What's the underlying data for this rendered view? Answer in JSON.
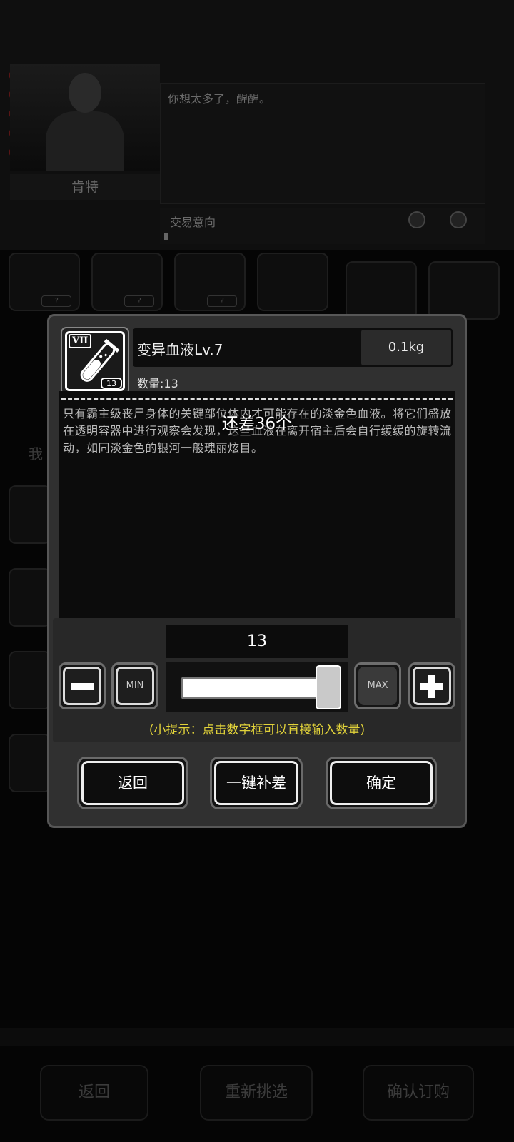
{
  "background": {
    "npc_name": "肯特",
    "dialog_text": "你想太多了，醒醒。",
    "trade_intent_label": "交易意向",
    "side_tab_label": "我",
    "slot_tag": "?",
    "buttons": {
      "back": "返回",
      "reselect": "重新挑选",
      "confirm_order": "确认订购"
    }
  },
  "modal": {
    "item": {
      "grade": "VII",
      "icon": "test-tube-icon",
      "icon_qty": "13",
      "name": "变异血液Lv.7",
      "weight": "0.1kg",
      "count_label": "数量:13"
    },
    "remaining_text": "还差36个",
    "description": "只有霸主级丧尸身体的关键部位体内才可能存在的淡金色血液。将它们盛放在透明容器中进行观察会发现，这些血液在离开宿主后会自行缓缓的旋转流动，如同淡金色的银河一般瑰丽炫目。",
    "quantity": {
      "value": "13",
      "slider_fraction": 1.0,
      "min_label": "MIN",
      "max_label": "MAX"
    },
    "hint": "(小提示：点击数字框可以直接输入数量)",
    "buttons": {
      "back": "返回",
      "fill_gap": "一键补差",
      "confirm": "确定"
    }
  },
  "colors": {
    "hint": "#e2d33a",
    "modal_bg": "#303030",
    "modal_border": "#575757"
  }
}
